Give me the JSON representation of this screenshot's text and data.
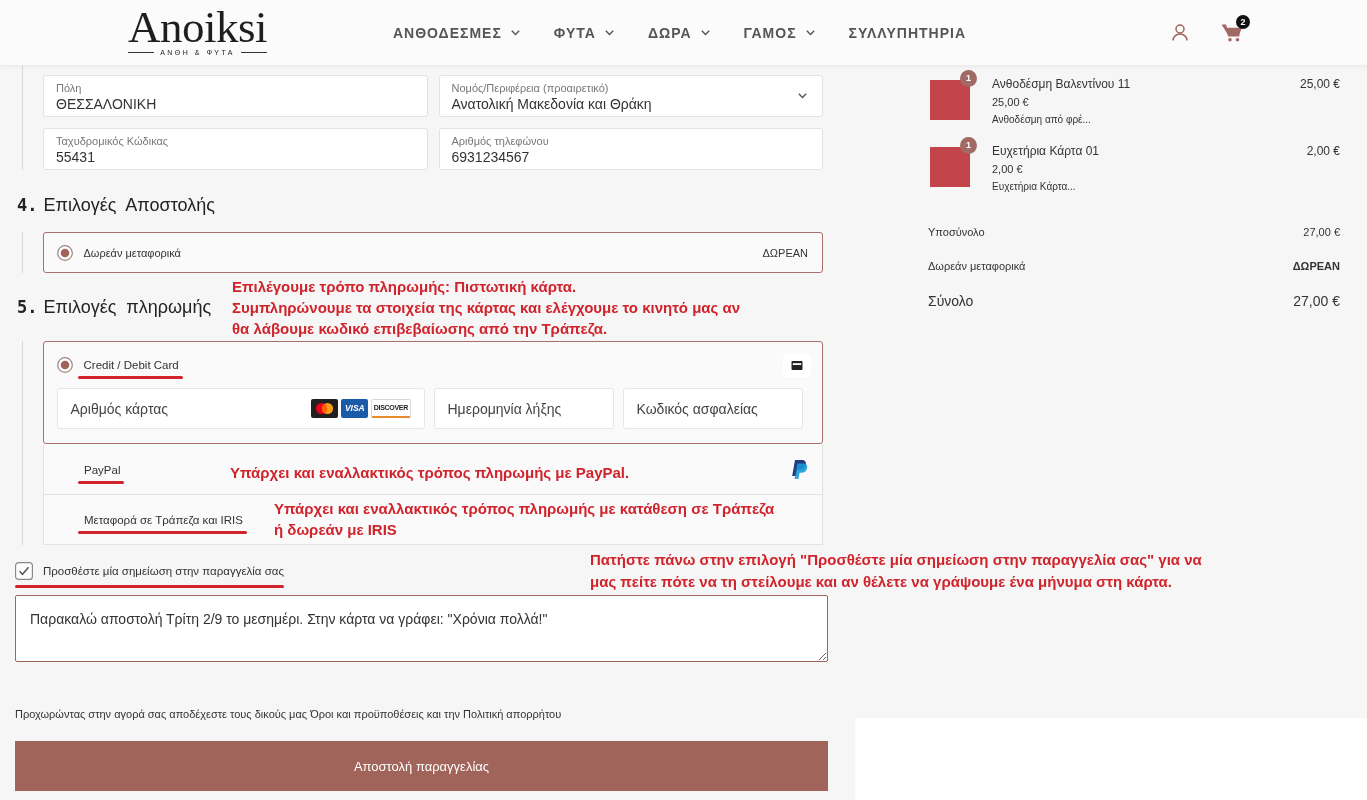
{
  "header": {
    "logo": {
      "name": "Anoiksi",
      "tagline": "ΑΝΘΗ & ΦΥΤΑ"
    },
    "nav": [
      {
        "label": "ΑΝΘΟΔΕΣΜΕΣ",
        "has_menu": true
      },
      {
        "label": "ΦΥΤΑ",
        "has_menu": true
      },
      {
        "label": "ΔΩΡΑ",
        "has_menu": true
      },
      {
        "label": "ΓΑΜΟΣ",
        "has_menu": true
      },
      {
        "label": "ΣΥΛΛΥΠΗΤΗΡΙΑ",
        "has_menu": false
      }
    ],
    "cart_count": "2"
  },
  "address_fields": [
    {
      "kind": "text",
      "label": "Πόλη",
      "value": "ΘΕΣΣΑΛΟΝΙΚΗ"
    },
    {
      "kind": "select",
      "label": "Νομός/Περιφέρεια (προαιρετικό)",
      "value": "Ανατολική Μακεδονία και Θράκη"
    },
    {
      "kind": "text",
      "label": "Ταχυδρομικός Κώδικας",
      "value": "55431"
    },
    {
      "kind": "text",
      "label": "Αριθμός τηλεφώνου",
      "value": "6931234567"
    }
  ],
  "shipping": {
    "number": "4.",
    "title": "Επιλογές Αποστολής",
    "options": [
      {
        "label": "Δωρεάν μεταφορικά",
        "price": "ΔΩΡΕΑΝ",
        "selected": true
      }
    ]
  },
  "payment": {
    "number": "5.",
    "title": "Επιλογές πληρωμής",
    "annotation": {
      "lines": [
        "Επιλέγουμε τρόπο πληρωμής: Πιστωτική κάρτα.",
        "Συμπληρώνουμε τα στοιχεία της κάρτας και ελέγχουμε το κινητό μας αν",
        "θα λάβουμε κωδικό επιβεβαίωσης από την Τράπεζα."
      ]
    },
    "methods": [
      {
        "kind": "card",
        "label": "Credit / Debit Card",
        "selected": true,
        "underlined": true,
        "card_logos": [
          {
            "kind": "circles"
          },
          {
            "kind": "filled",
            "text": "VISA"
          },
          {
            "kind": "outlined",
            "text": "DISCOVER"
          }
        ],
        "fields": [
          {
            "placeholder": "Αριθμός κάρτας"
          },
          {
            "placeholder": "Ημερομηνία λήξης"
          },
          {
            "placeholder": "Κωδικός ασφαλείας"
          }
        ]
      },
      {
        "kind": "paypal",
        "label": "PayPal",
        "selected": false,
        "underlined": true,
        "annotation": {
          "lines": [
            "Υπάρχει και εναλλακτικός τρόπος πληρωμής με PayPal."
          ]
        }
      },
      {
        "kind": "bank",
        "label": "Μεταφορά σε Τράπεζα και IRIS",
        "selected": false,
        "underlined": true,
        "annotation": {
          "lines": [
            "Υπάρχει και εναλλακτικός τρόπος πληρωμής με κατάθεση σε Τράπεζα",
            "ή δωρεάν με IRIS"
          ]
        }
      }
    ]
  },
  "note": {
    "label": "Προσθέστε μία σημείωση στην παραγγελία σας",
    "checked": true,
    "underlined": true,
    "value": "Παρακαλώ αποστολή Τρίτη 2/9 το μεσημέρι. Στην κάρτα να γράφει: \"Χρόνια πολλά!\"",
    "annotation": {
      "lines": [
        "Πατήστε πάνω στην επιλογή \"Προσθέστε μία σημείωση στην παραγγελία σας\" για να",
        "μας πείτε πότε να τη στείλουμε και αν θέλετε να γράψουμε ένα μήνυμα στη κάρτα."
      ]
    }
  },
  "terms": "Προχωρώντας στην αγορά σας αποδέχεστε τους δικούς μας Όροι και προϋποθέσεις και την Πολιτική απορρήτου",
  "submit": "Αποστολή παραγγελίας",
  "summary": {
    "items": [
      {
        "name": "Ανθοδέσμη Βαλεντίνου 11",
        "quantity": "1",
        "unit_price": "25,00 €",
        "description": "Ανθοδέσμη από φρέ...",
        "total": "25,00 €"
      },
      {
        "name": "Ευχετήρια Κάρτα 01",
        "quantity": "1",
        "unit_price": "2,00 €",
        "description": "Ευχετήρια Κάρτα...",
        "total": "2,00 €"
      }
    ],
    "rows": [
      {
        "kind": "subtotal",
        "label": "Υποσύνολο",
        "value": "27,00 €"
      },
      {
        "kind": "shipping",
        "label": "Δωρεάν μεταφορικά",
        "value": "ΔΩΡΕΑΝ"
      }
    ],
    "total": {
      "label": "Σύνολο",
      "value": "27,00 €"
    }
  }
}
